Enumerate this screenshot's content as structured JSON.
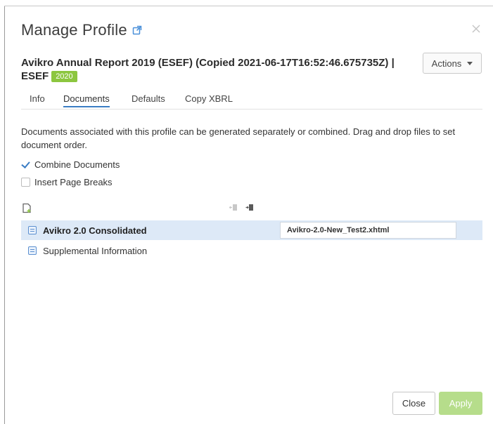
{
  "dialog": {
    "title": "Manage Profile",
    "heading": "Avikro Annual Report 2019 (ESEF) (Copied 2021-06-17T16:52:46.675735Z) | ESEF",
    "year_badge": "2020",
    "actions_label": "Actions"
  },
  "tabs": [
    {
      "label": "Info",
      "active": false
    },
    {
      "label": "Documents",
      "active": true
    },
    {
      "label": "Defaults",
      "active": false
    },
    {
      "label": "Copy XBRL",
      "active": false
    }
  ],
  "documents_tab": {
    "description": "Documents associated with this profile can be generated separately or combined. Drag and drop files to set document order.",
    "combine_documents": {
      "label": "Combine Documents",
      "checked": true
    },
    "insert_page_breaks": {
      "label": "Insert Page Breaks",
      "checked": false
    },
    "documents": [
      {
        "name": "Avikro 2.0 Consolidated",
        "file_name": "Avikro-2.0-New_Test2.xhtml",
        "selected": true
      },
      {
        "name": "Supplemental Information",
        "selected": false
      }
    ]
  },
  "footer": {
    "close_label": "Close",
    "apply_label": "Apply"
  },
  "colors": {
    "accent": "#3b7dc4",
    "badge": "#8cc63f",
    "selected_row": "#dde9f7",
    "apply_disabled": "#b6dd8b"
  },
  "icons": [
    "external-link-icon",
    "close-icon",
    "chevron-down-icon",
    "add-document-icon",
    "move-out-icon",
    "move-in-icon",
    "document-icon"
  ]
}
